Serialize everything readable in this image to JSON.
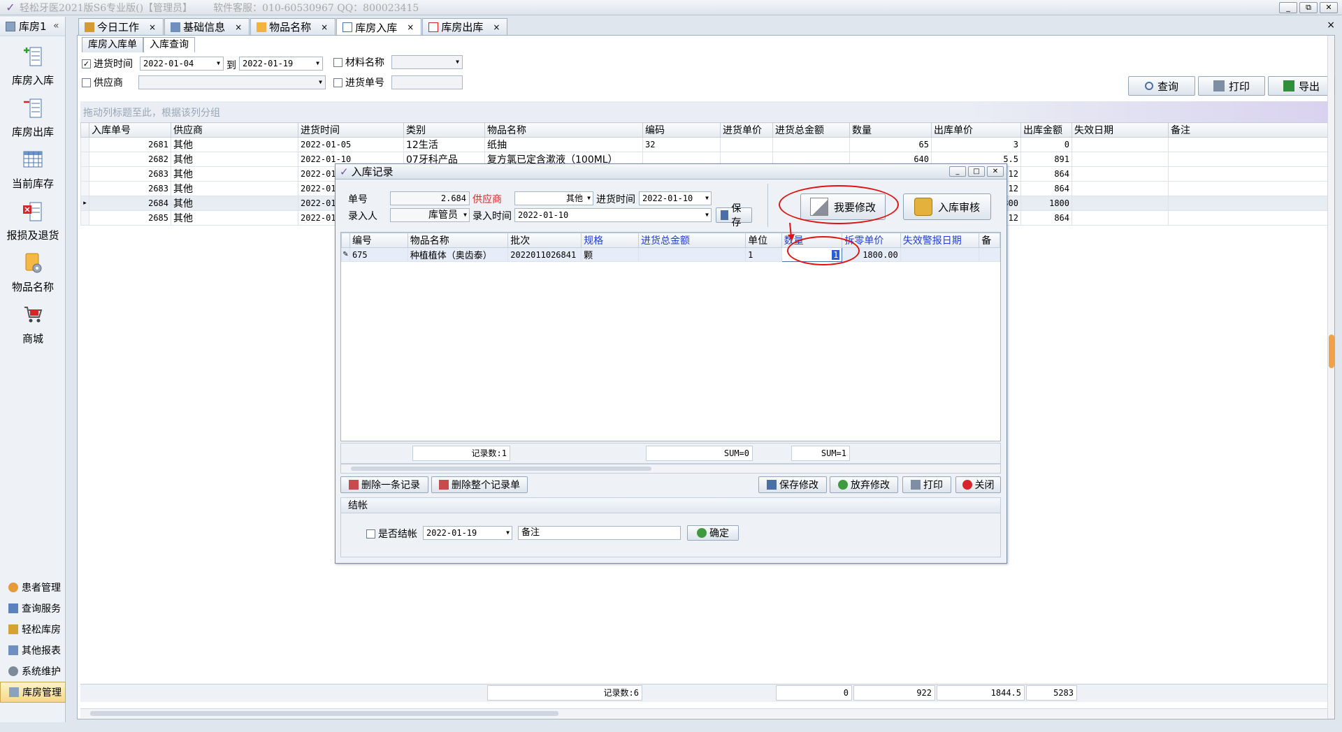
{
  "app": {
    "title": "轻松牙医2021版S6专业版()【管理员】",
    "service": "软件客服：010-60530967 QQ：800023415",
    "window_buttons": [
      "_",
      "⧉",
      "✕"
    ]
  },
  "sidebar": {
    "header": "库房1",
    "collapse": "«",
    "items": [
      {
        "label": "库房入库",
        "icon": "stock-in-icon"
      },
      {
        "label": "库房出库",
        "icon": "stock-out-icon"
      },
      {
        "label": "当前库存",
        "icon": "inventory-grid-icon"
      },
      {
        "label": "报损及退货",
        "icon": "loss-return-icon"
      },
      {
        "label": "物品名称",
        "icon": "item-names-icon"
      },
      {
        "label": "商城",
        "icon": "shop-cart-icon"
      }
    ],
    "nav": [
      {
        "label": "患者管理",
        "icon": "patients-icon"
      },
      {
        "label": "查询服务",
        "icon": "query-icon"
      },
      {
        "label": "轻松库房",
        "icon": "warehouse-icon"
      },
      {
        "label": "其他报表",
        "icon": "reports-icon"
      },
      {
        "label": "系统维护",
        "icon": "maintenance-icon"
      },
      {
        "label": "库房管理",
        "icon": "storage-manage-icon",
        "active": true
      }
    ]
  },
  "tabs": [
    {
      "label": "今日工作",
      "close": "×"
    },
    {
      "label": "基础信息",
      "close": "×"
    },
    {
      "label": "物品名称",
      "close": "×"
    },
    {
      "label": "库房入库",
      "close": "×",
      "active": true
    },
    {
      "label": "库房出库",
      "close": "×"
    }
  ],
  "close_all": "×",
  "subtabs": [
    {
      "label": "库房入库单"
    },
    {
      "label": "入库查询",
      "active": true
    }
  ],
  "filters": {
    "purchase_time_label": "进货时间",
    "purchase_time_checked": true,
    "date_from": "2022-01-04",
    "to_label": "到",
    "date_to": "2022-01-19",
    "material_name_label": "材料名称",
    "supplier_label": "供应商",
    "purchase_no_label": "进货单号",
    "check_mark": "✓"
  },
  "toolbar": {
    "query": "查询",
    "print": "打印",
    "export": "导出"
  },
  "group_panel_hint": "拖动列标题至此，根据该列分组",
  "main_grid": {
    "columns": [
      "入库单号",
      "供应商",
      "进货时间",
      "类别",
      "物品名称",
      "编码",
      "进货单价",
      "进货总金额",
      "数量",
      "出库单价",
      "出库金额",
      "失效日期",
      "备注"
    ],
    "rows": [
      {
        "id": "2681",
        "supplier": "其他",
        "time": "2022-01-05",
        "category": "12生活",
        "name": "纸抽",
        "code": "32",
        "price": "",
        "total": "",
        "qty": "65",
        "out_price": "3",
        "out_amount": "0",
        "expire": "",
        "note": ""
      },
      {
        "id": "2682",
        "supplier": "其他",
        "time": "2022-01-10",
        "category": "07牙科产品",
        "name": "复方氯已定含漱液（100ML）",
        "code": "",
        "price": "",
        "total": "",
        "qty": "640",
        "out_price": "5.5",
        "out_amount": "891",
        "expire": "",
        "note": ""
      },
      {
        "id": "2683",
        "supplier": "其他",
        "time": "2022-01",
        "category": "",
        "name": "",
        "code": "",
        "price": "",
        "total": "",
        "qty": "",
        "out_price": "12",
        "out_amount": "864",
        "expire": "",
        "note": ""
      },
      {
        "id": "2683",
        "supplier": "其他",
        "time": "2022-01",
        "category": "",
        "name": "",
        "code": "",
        "price": "",
        "total": "",
        "qty": "",
        "out_price": "12",
        "out_amount": "864",
        "expire": "",
        "note": ""
      },
      {
        "id": "2684",
        "supplier": "其他",
        "time": "2022-01",
        "category": "",
        "name": "",
        "code": "",
        "price": "",
        "total": "",
        "qty": "",
        "out_price": "300",
        "out_amount": "1800",
        "expire": "",
        "note": "",
        "selected": true
      },
      {
        "id": "2685",
        "supplier": "其他",
        "time": "2022-01",
        "category": "",
        "name": "",
        "code": "",
        "price": "",
        "total": "",
        "qty": "",
        "out_price": "12",
        "out_amount": "864",
        "expire": "",
        "note": ""
      }
    ],
    "row_indicator": "▸",
    "footer": {
      "count": "记录数:6",
      "total": "0",
      "qty": "922",
      "out_price": "1844.5",
      "out_amount": "5283"
    }
  },
  "dialog": {
    "title": "入库记录",
    "window_buttons": [
      "_",
      "□",
      "✕"
    ],
    "doc_no_label": "单号",
    "doc_no": "2.684",
    "supplier_label": "供应商",
    "supplier": "其他",
    "purchase_time_label": "进货时间",
    "purchase_time": "2022-01-10",
    "entered_by_label": "录入人",
    "entered_by": "库管员",
    "entry_time_label": "录入时间",
    "entry_time": "2022-01-10",
    "save_label": "保存",
    "modify_button": "我要修改",
    "audit_button": "入库审核",
    "grid": {
      "columns": [
        {
          "label": "编号",
          "blue": false
        },
        {
          "label": "物品名称",
          "blue": false
        },
        {
          "label": "批次",
          "blue": false
        },
        {
          "label": "规格",
          "blue": true
        },
        {
          "label": "进货总金额",
          "blue": true
        },
        {
          "label": "单位",
          "blue": false
        },
        {
          "label": "数量",
          "blue": true
        },
        {
          "label": "拆零单价",
          "blue": true
        },
        {
          "label": "失效警报日期",
          "blue": true
        },
        {
          "label": "备",
          "blue": false
        }
      ],
      "row": {
        "indicator": "✎",
        "id": "675",
        "name": "种植植体（奥齿泰）",
        "batch": "2022011026841",
        "spec": "颗",
        "total": "",
        "unit": "1",
        "qty": "1",
        "unit_price": "1800.00",
        "alert_date": "",
        "note": ""
      },
      "footer": {
        "count": "记录数:1",
        "sum_total": "SUM=0",
        "sum_qty": "SUM=1"
      }
    },
    "actions": {
      "delete_one": "删除一条记录",
      "delete_all": "删除整个记录单",
      "save_changes": "保存修改",
      "discard_changes": "放弃修改",
      "print": "打印",
      "close": "关闭"
    },
    "settle": {
      "header": "结帐",
      "is_settled_label": "是否结帐",
      "date": "2022-01-19",
      "note_placeholder": "备注",
      "confirm": "确定"
    }
  },
  "colors": {
    "accent_red": "#e31212",
    "blue_header": "#1f3fd8",
    "active_nav": "#f4d98a"
  }
}
